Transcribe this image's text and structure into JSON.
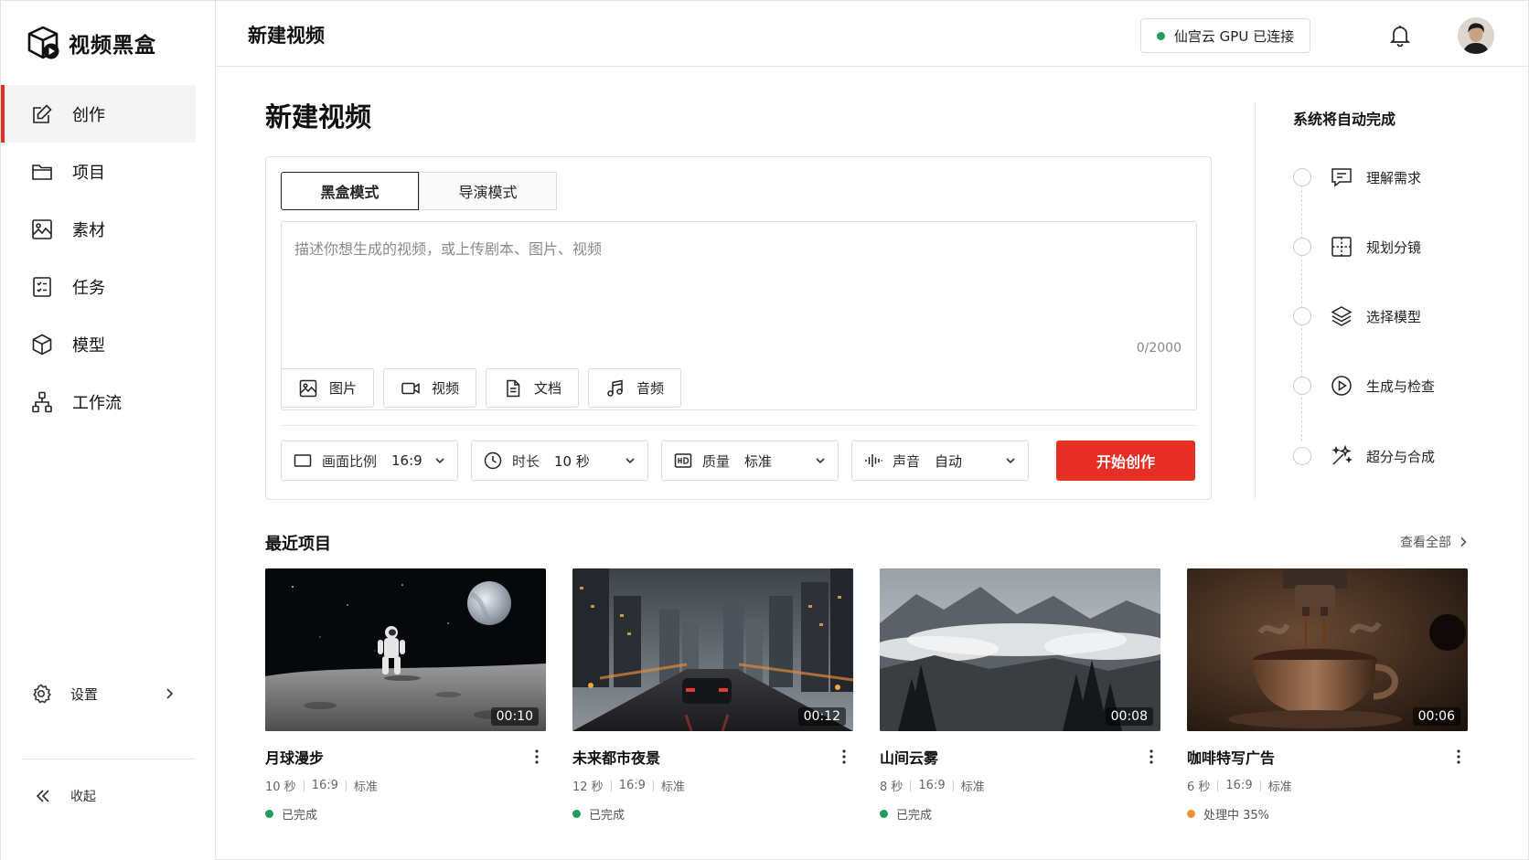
{
  "app": {
    "name": "视频黑盒"
  },
  "sidebar": {
    "items": [
      {
        "label": "创作",
        "icon": "edit-icon",
        "active": true
      },
      {
        "label": "项目",
        "icon": "folder-icon"
      },
      {
        "label": "素材",
        "icon": "image-icon"
      },
      {
        "label": "任务",
        "icon": "checklist-icon"
      },
      {
        "label": "模型",
        "icon": "cube-icon"
      },
      {
        "label": "工作流",
        "icon": "workflow-icon"
      }
    ],
    "settings_label": "设置",
    "collapse_label": "收起"
  },
  "header": {
    "title": "新建视频",
    "gpu_status": "仙宫云 GPU 已连接"
  },
  "main": {
    "title": "新建视频",
    "mode_tabs": [
      "黑盒模式",
      "导演模式"
    ],
    "prompt_placeholder": "描述你想生成的视频，或上传剧本、图片、视频",
    "prompt_value": "",
    "counter": "0/2000",
    "upload_buttons": [
      {
        "label": "图片",
        "icon": "image-icon"
      },
      {
        "label": "视频",
        "icon": "video-icon"
      },
      {
        "label": "文档",
        "icon": "document-icon"
      },
      {
        "label": "音频",
        "icon": "music-icon"
      }
    ],
    "options": [
      {
        "label": "画面比例",
        "value": "16:9",
        "icon": "aspect-ratio-icon"
      },
      {
        "label": "时长",
        "value": "10 秒",
        "icon": "clock-icon"
      },
      {
        "label": "质量",
        "value": "标准",
        "icon": "hd-icon"
      },
      {
        "label": "声音",
        "value": "自动",
        "icon": "waveform-icon"
      }
    ],
    "start_button": "开始创作"
  },
  "steps_panel": {
    "title": "系统将自动完成",
    "steps": [
      {
        "label": "理解需求",
        "icon": "message-icon"
      },
      {
        "label": "规划分镜",
        "icon": "storyboard-icon"
      },
      {
        "label": "选择模型",
        "icon": "layers-icon"
      },
      {
        "label": "生成与检查",
        "icon": "play-circle-icon"
      },
      {
        "label": "超分与合成",
        "icon": "sparkle-icon"
      }
    ]
  },
  "recent": {
    "title": "最近项目",
    "view_all": "查看全部",
    "projects": [
      {
        "title": "月球漫步",
        "duration": "00:10",
        "length": "10 秒",
        "ratio": "16:9",
        "quality": "标准",
        "status": "已完成",
        "status_color": "#1e9e5a"
      },
      {
        "title": "未来都市夜景",
        "duration": "00:12",
        "length": "12 秒",
        "ratio": "16:9",
        "quality": "标准",
        "status": "已完成",
        "status_color": "#1e9e5a"
      },
      {
        "title": "山间云雾",
        "duration": "00:08",
        "length": "8 秒",
        "ratio": "16:9",
        "quality": "标准",
        "status": "已完成",
        "status_color": "#1e9e5a"
      },
      {
        "title": "咖啡特写广告",
        "duration": "00:06",
        "length": "6 秒",
        "ratio": "16:9",
        "quality": "标准",
        "status": "处理中 35%",
        "status_color": "#f0912e"
      }
    ]
  },
  "colors": {
    "accent": "#e62e24",
    "success": "#1e9e5a",
    "processing": "#f0912e"
  }
}
